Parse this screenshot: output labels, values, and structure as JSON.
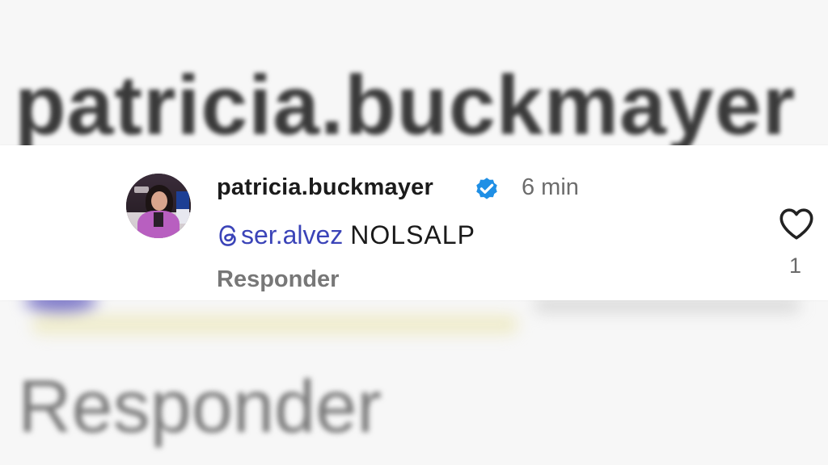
{
  "background": {
    "username_zoom": "patricia.buckmayer",
    "reply_zoom": "Responder"
  },
  "comment": {
    "username": "patricia.buckmayer",
    "verified_icon": "verified-badge-icon",
    "timestamp": "6 min",
    "mention": "ser.alvez",
    "mention_icon": "threads-icon",
    "text": "NOLSALP",
    "reply_label": "Responder",
    "like_icon": "heart-outline-icon",
    "like_count": "1"
  },
  "colors": {
    "mention": "#3b44b8",
    "verified": "#1f8fe5",
    "muted_text": "#777777",
    "primary_text": "#1b1b1b"
  }
}
